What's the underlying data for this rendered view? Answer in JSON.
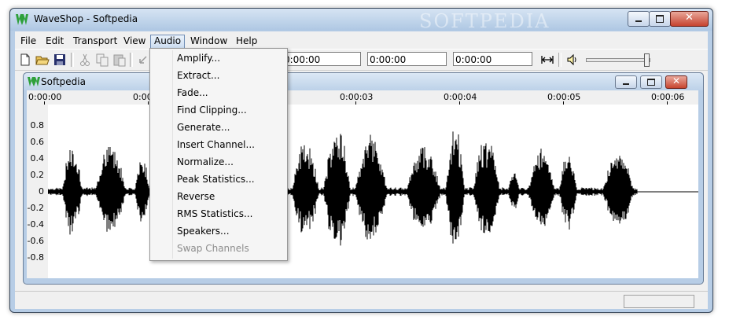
{
  "window": {
    "title": "WaveShop - Softpedia",
    "watermark": "SOFTPEDIA",
    "accent": "#2ea03a"
  },
  "menubar": [
    "File",
    "Edit",
    "Transport",
    "View",
    "Audio",
    "Window",
    "Help"
  ],
  "toolbar": {
    "icons": [
      "new-file-icon",
      "open-folder-icon",
      "save-icon",
      "cut-icon",
      "copy-icon",
      "paste-icon",
      "undo-icon",
      "fit-width-icon",
      "speaker-icon"
    ],
    "times": [
      "0:00:00",
      "0:00:00",
      "0:00:00"
    ],
    "volume_level": 0.95
  },
  "child": {
    "title": "Softpedia",
    "timeline": [
      "0:00:00",
      "0:00",
      "0:00:03",
      "0:00:04",
      "0:00:05",
      "0:00:06"
    ],
    "yaxis": [
      "0.8",
      "0.6",
      "0.4",
      "0.2",
      "0",
      "-0.2",
      "-0.4",
      "-0.6",
      "-0.8"
    ]
  },
  "audio_menu": {
    "items": [
      {
        "label": "Amplify...",
        "enabled": true
      },
      {
        "label": "Extract...",
        "enabled": true
      },
      {
        "label": "Fade...",
        "enabled": true
      },
      {
        "label": "Find Clipping...",
        "enabled": true
      },
      {
        "label": "Generate...",
        "enabled": true
      },
      {
        "label": "Insert Channel...",
        "enabled": true
      },
      {
        "label": "Normalize...",
        "enabled": true
      },
      {
        "label": "Peak Statistics...",
        "enabled": true
      },
      {
        "label": "Reverse",
        "enabled": true
      },
      {
        "label": "RMS Statistics...",
        "enabled": true
      },
      {
        "label": "Speakers...",
        "enabled": true
      },
      {
        "label": "Swap Channels",
        "enabled": false
      }
    ]
  }
}
